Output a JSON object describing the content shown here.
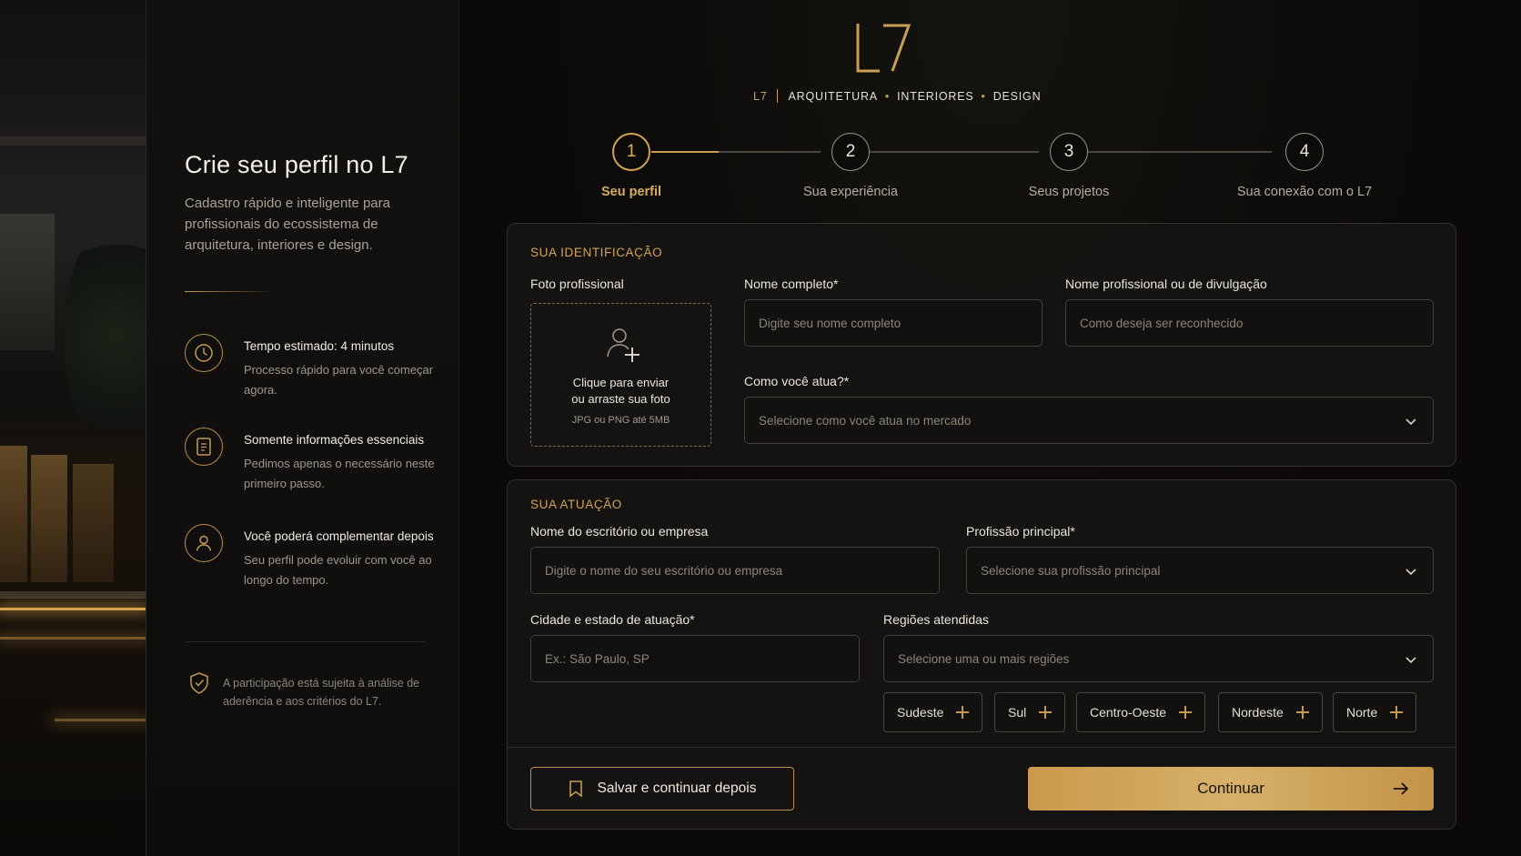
{
  "brand": {
    "logo_text": "L7",
    "tagline_brand": "L7",
    "tagline_items": [
      "ARQUITETURA",
      "INTERIORES",
      "DESIGN"
    ]
  },
  "sidebar": {
    "title": "Crie seu perfil no L7",
    "subtitle": "Cadastro rápido e inteligente para profissionais do ecossistema de arquitetura, interiores e design.",
    "features": [
      {
        "icon": "clock-icon",
        "title": "Tempo estimado: 4 minutos",
        "desc": "Processo rápido para você começar agora."
      },
      {
        "icon": "document-icon",
        "title": "Somente informações essenciais",
        "desc": "Pedimos apenas o necessário neste primeiro passo."
      },
      {
        "icon": "user-icon",
        "title": "Você poderá complementar depois",
        "desc": "Seu perfil pode evoluir com você ao longo do tempo."
      }
    ],
    "note": "A participação está sujeita à análise de aderência e aos critérios do L7."
  },
  "stepper": {
    "current_step": 1,
    "progress_to_next": 0.4,
    "steps": [
      {
        "number": "1",
        "label": "Seu perfil"
      },
      {
        "number": "2",
        "label": "Sua experiência"
      },
      {
        "number": "3",
        "label": "Seus projetos"
      },
      {
        "number": "4",
        "label": "Sua conexão com o L7"
      }
    ]
  },
  "identification": {
    "section_title": "SUA IDENTIFICAÇÃO",
    "photo_label": "Foto profissional",
    "upload_text_line1": "Clique para enviar",
    "upload_text_line2": "ou arraste sua foto",
    "upload_hint": "JPG ou PNG até 5MB",
    "full_name_label": "Nome completo*",
    "full_name_placeholder": "Digite seu nome completo",
    "pro_name_label": "Nome profissional ou de divulgação",
    "pro_name_placeholder": "Como deseja ser reconhecido",
    "role_label": "Como você atua?*",
    "role_placeholder": "Selecione como você atua no mercado"
  },
  "practice": {
    "section_title": "SUA ATUAÇÃO",
    "office_label": "Nome do escritório ou empresa",
    "office_placeholder": "Digite o nome do seu escritório ou empresa",
    "profession_label": "Profissão principal*",
    "profession_placeholder": "Selecione sua profissão principal",
    "city_label": "Cidade e estado de atuação*",
    "city_placeholder": "Ex.: São Paulo, SP",
    "regions_label": "Regiões atendidas",
    "regions_placeholder": "Selecione uma ou mais regiões",
    "region_chips": [
      "Sudeste",
      "Sul",
      "Centro-Oeste",
      "Nordeste",
      "Norte"
    ]
  },
  "actions": {
    "save_label": "Salvar e continuar depois",
    "continue_label": "Continuar"
  },
  "colors": {
    "accent": "#d1a456",
    "background": "#0b0a09",
    "button_gradient_start": "#c99a4a",
    "button_gradient_end": "#d7b06a"
  }
}
